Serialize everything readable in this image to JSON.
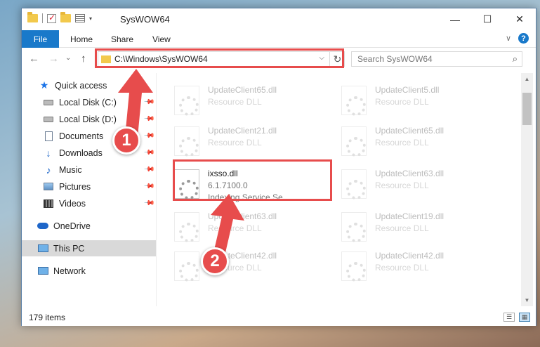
{
  "window": {
    "title": "SysWOW64",
    "controls": {
      "minimize": "—",
      "maximize": "☐",
      "close": "✕"
    }
  },
  "ribbon": {
    "file": "File",
    "tabs": [
      "Home",
      "Share",
      "View"
    ],
    "expand_icon": "∨",
    "help": "?"
  },
  "nav": {
    "back": "←",
    "forward": "→",
    "recent": "⌄",
    "up": "↑",
    "address": "C:\\Windows\\SysWOW64",
    "search_placeholder": "Search SysWOW64"
  },
  "sidebar": {
    "items": [
      {
        "label": "Quick access",
        "icon": "star-icon",
        "pinned": false
      },
      {
        "label": "Local Disk (C:)",
        "icon": "drive-icon",
        "pinned": true
      },
      {
        "label": "Local Disk (D:)",
        "icon": "drive-icon",
        "pinned": true
      },
      {
        "label": "Documents",
        "icon": "documents-icon",
        "pinned": true
      },
      {
        "label": "Downloads",
        "icon": "downloads-icon",
        "pinned": true
      },
      {
        "label": "Music",
        "icon": "music-icon",
        "pinned": true
      },
      {
        "label": "Pictures",
        "icon": "pictures-icon",
        "pinned": true
      },
      {
        "label": "Videos",
        "icon": "videos-icon",
        "pinned": true
      },
      {
        "label": "OneDrive",
        "icon": "onedrive-icon",
        "pinned": false
      },
      {
        "label": "This PC",
        "icon": "this-pc-icon",
        "pinned": false,
        "selected": true
      },
      {
        "label": "Network",
        "icon": "network-icon",
        "pinned": false
      }
    ]
  },
  "files": [
    {
      "name": "UpdateClient65.dll",
      "type": "Resource DLL",
      "faded": true
    },
    {
      "name": "UpdateClient5.dll",
      "type": "Resource DLL",
      "faded": true
    },
    {
      "name": "UpdateClient21.dll",
      "type": "Resource DLL",
      "faded": true
    },
    {
      "name": "UpdateClient65.dll",
      "type": "Resource DLL",
      "faded": true
    },
    {
      "name": "ixsso.dll",
      "type": "6.1.7100.0",
      "description": "Indexing Service Se...",
      "faded": false
    },
    {
      "name": "UpdateClient63.dll",
      "type": "Resource DLL",
      "faded": true
    },
    {
      "name": "UpdateClient63.dll",
      "type": "Resource DLL",
      "faded": true
    },
    {
      "name": "UpdateClient19.dll",
      "type": "Resource DLL",
      "faded": true
    },
    {
      "name": "UpdateClient42.dll",
      "type": "Resource DLL",
      "faded": true
    },
    {
      "name": "UpdateClient42.dll",
      "type": "Resource DLL",
      "faded": true
    }
  ],
  "status": {
    "item_count": "179 items"
  },
  "annotations": {
    "step1": "1",
    "step2": "2",
    "color": "#e74c4c"
  }
}
